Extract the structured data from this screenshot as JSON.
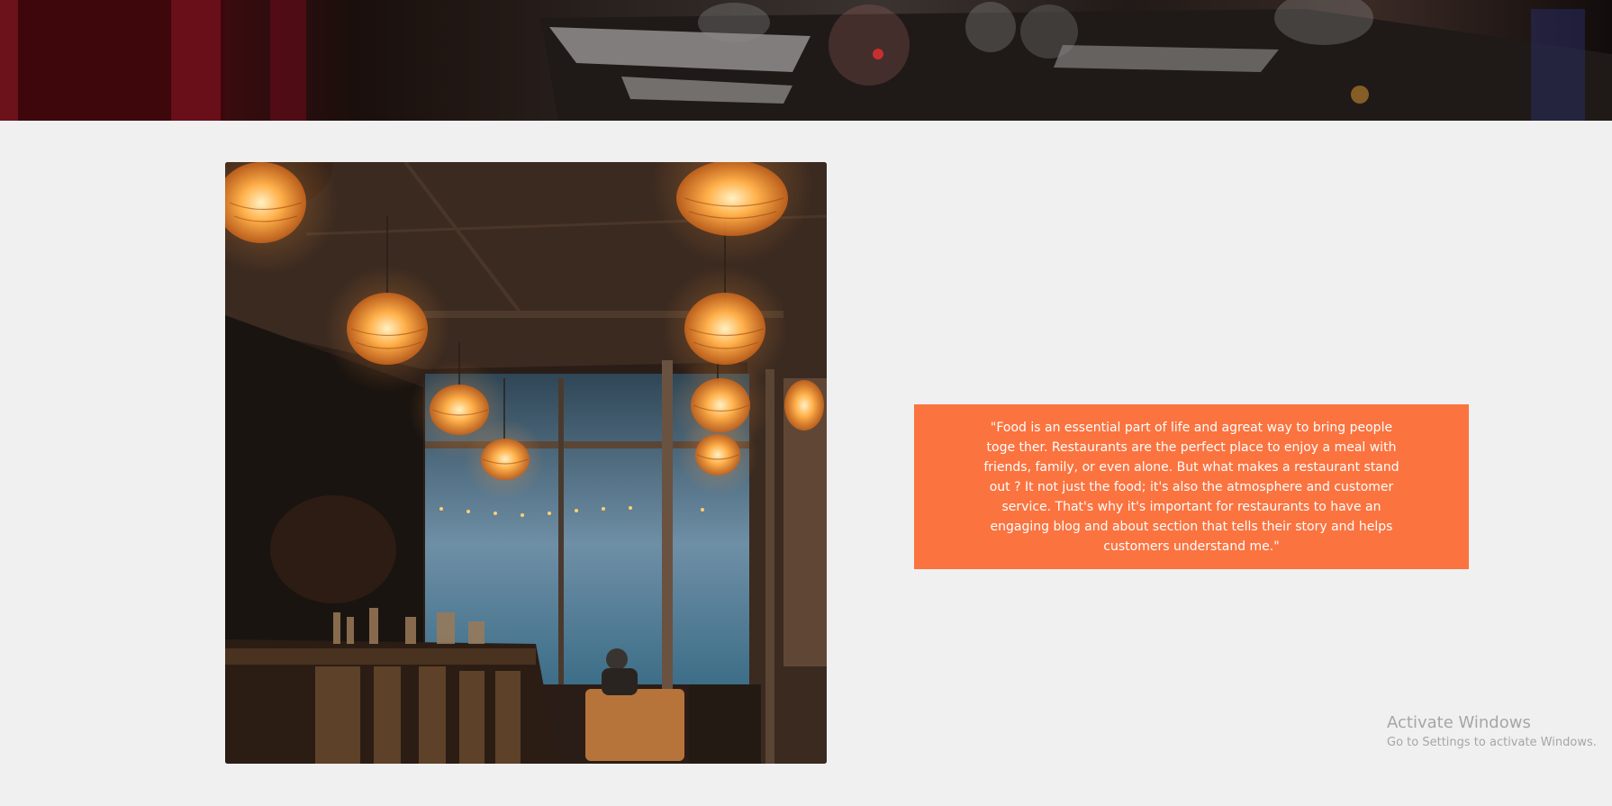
{
  "hero": {
    "image_name": "restaurant-table-photo"
  },
  "gallery": {
    "image_name": "restaurant-interior-photo"
  },
  "quote": {
    "text": "\"Food is an essential part of life and agreat way to bring people toge ther. Restaurants are the perfect place to enjoy a meal with friends, family, or even alone. But what makes a restaurant stand out ? It not just the food; it's also the atmosphere and customer service. That's why it's important for restaurants to have an engaging blog and about section that tells their story and helps customers understand me.\"",
    "background_color": "#fb733f",
    "text_color": "#ffffff"
  },
  "watermark": {
    "title": "Activate Windows",
    "subtitle": "Go to Settings to activate Windows."
  },
  "colors": {
    "page_background": "#f0f0f0",
    "accent": "#fb733f"
  }
}
